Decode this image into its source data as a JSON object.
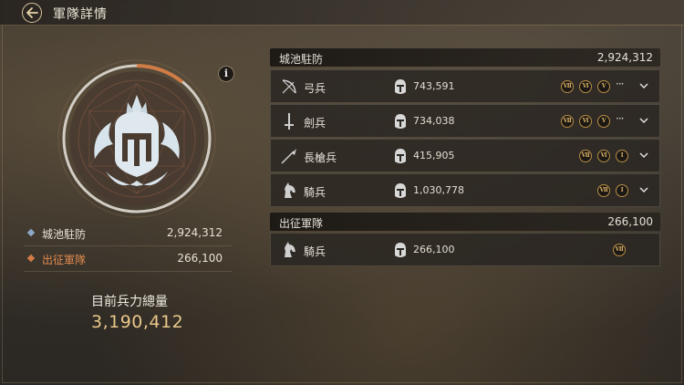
{
  "header": {
    "title": "軍隊詳情"
  },
  "stats": {
    "garrison_label": "城池駐防",
    "garrison_value": "2,924,312",
    "garrison_color": "#8fa8c8",
    "expedition_label": "出征軍隊",
    "expedition_value": "266,100",
    "expedition_color": "#d07c46",
    "total_label": "目前兵力總量",
    "total_value": "3,190,412"
  },
  "garrison_section": {
    "label": "城池駐防",
    "value": "2,924,312",
    "units": [
      {
        "icon": "bow-icon",
        "name": "弓兵",
        "count": "743,591",
        "tiers": [
          "Ⅶ",
          "Ⅵ",
          "Ⅴ"
        ],
        "more": "···"
      },
      {
        "icon": "sword-icon",
        "name": "劍兵",
        "count": "734,038",
        "tiers": [
          "Ⅶ",
          "Ⅵ",
          "Ⅴ"
        ],
        "more": "···"
      },
      {
        "icon": "spear-icon",
        "name": "長槍兵",
        "count": "415,905",
        "tiers": [
          "Ⅶ",
          "Ⅵ",
          "Ⅰ"
        ]
      },
      {
        "icon": "horse-icon",
        "name": "騎兵",
        "count": "1,030,778",
        "tiers": [
          "Ⅶ",
          "Ⅰ"
        ]
      }
    ]
  },
  "expedition_section": {
    "label": "出征軍隊",
    "value": "266,100",
    "units": [
      {
        "icon": "horse-icon",
        "name": "騎兵",
        "count": "266,100",
        "tiers": [
          "Ⅶ"
        ]
      }
    ]
  }
}
